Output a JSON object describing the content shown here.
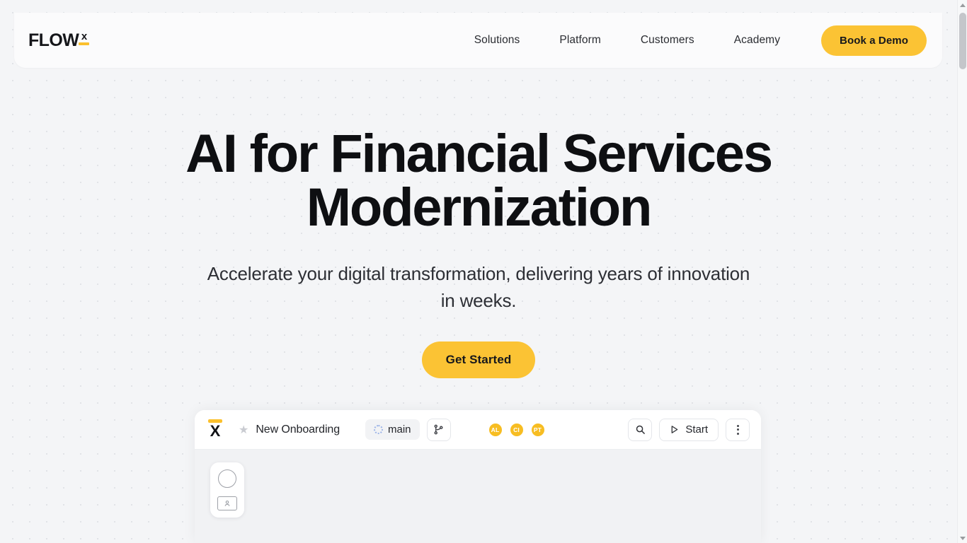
{
  "header": {
    "logo": {
      "word": "FLOW",
      "mark": "x"
    },
    "nav": [
      {
        "label": "Solutions"
      },
      {
        "label": "Platform"
      },
      {
        "label": "Customers"
      },
      {
        "label": "Academy"
      }
    ],
    "cta": {
      "label": "Book a Demo",
      "color": "#fbc334"
    }
  },
  "hero": {
    "headline": "AI for Financial Services Modernization",
    "subhead": "Accelerate your digital transformation, delivering years of innovation in weeks.",
    "cta": {
      "label": "Get Started",
      "color": "#fbc334"
    }
  },
  "mockup": {
    "logo_mark": "X",
    "star_icon": "star-icon",
    "project_title": "New Onboarding",
    "branch": {
      "label": "main",
      "icon": "dotted-circle-icon"
    },
    "branch_button_icon": "git-branch-icon",
    "avatars": [
      {
        "initials": "AL"
      },
      {
        "initials": "CI"
      },
      {
        "initials": "PT"
      }
    ],
    "search_icon": "search-icon",
    "start_button": {
      "label": "Start",
      "icon": "play-icon"
    },
    "more_icon": "kebab-menu-icon",
    "tools": [
      {
        "name": "ellipse-tool-icon"
      },
      {
        "name": "user-card-tool-icon"
      }
    ]
  },
  "scrollbar": {
    "up_icon": "scroll-up-arrow-icon",
    "down_icon": "scroll-down-arrow-icon"
  }
}
